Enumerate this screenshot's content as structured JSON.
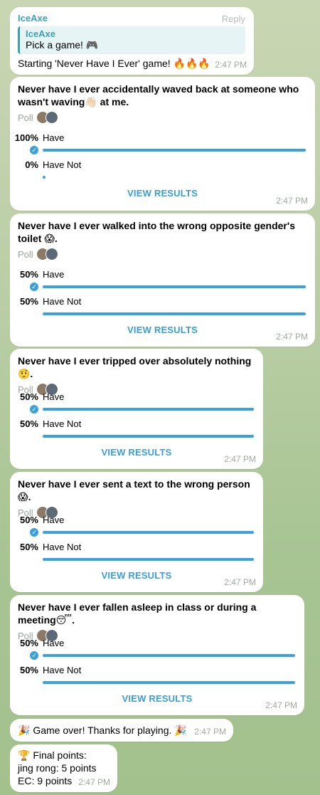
{
  "intro": {
    "sender": "IceAxe",
    "reply_label": "Reply",
    "quote_sender": "IceAxe",
    "quote_text": "Pick a game! 🎮",
    "text": "Starting 'Never Have I Ever' game! ",
    "fire": "🔥🔥🔥",
    "time": "2:47 PM"
  },
  "polls": [
    {
      "question": "Never have I ever accidentally waved back at someone who wasn't waving👋🏻 at me.",
      "poll_label": "Poll",
      "options": [
        {
          "pct": "100%",
          "label": "Have",
          "fraction": 1.0,
          "voted": true
        },
        {
          "pct": "0%",
          "label": "Have Not",
          "fraction": 0.0,
          "voted": false
        }
      ],
      "view_results": "VIEW RESULTS",
      "time": "2:47 PM"
    },
    {
      "question": "Never have I ever walked into the wrong opposite gender's toilet 😱.",
      "poll_label": "Poll",
      "options": [
        {
          "pct": "50%",
          "label": "Have",
          "fraction": 1.0,
          "voted": true
        },
        {
          "pct": "50%",
          "label": "Have Not",
          "fraction": 1.0,
          "voted": false
        }
      ],
      "view_results": "VIEW RESULTS",
      "time": "2:47 PM"
    },
    {
      "question": "Never have I ever tripped over absolutely nothing🤨.",
      "poll_label": "Poll",
      "options": [
        {
          "pct": "50%",
          "label": "Have",
          "fraction": 1.0,
          "voted": true
        },
        {
          "pct": "50%",
          "label": "Have Not",
          "fraction": 1.0,
          "voted": false
        }
      ],
      "view_results": "VIEW RESULTS",
      "time": "2:47 PM"
    },
    {
      "question": "Never have I ever sent a text to the wrong person😱.",
      "poll_label": "Poll",
      "options": [
        {
          "pct": "50%",
          "label": "Have",
          "fraction": 1.0,
          "voted": true
        },
        {
          "pct": "50%",
          "label": "Have Not",
          "fraction": 1.0,
          "voted": false
        }
      ],
      "view_results": "VIEW RESULTS",
      "time": "2:47 PM"
    },
    {
      "question": "Never have I ever fallen asleep in class or during a meeting😴.",
      "poll_label": "Poll",
      "options": [
        {
          "pct": "50%",
          "label": "Have",
          "fraction": 1.0,
          "voted": true
        },
        {
          "pct": "50%",
          "label": "Have Not",
          "fraction": 1.0,
          "voted": false
        }
      ],
      "view_results": "VIEW RESULTS",
      "time": "2:47 PM"
    }
  ],
  "game_over": {
    "text": "🎉 Game over! Thanks for playing. 🎉",
    "time": "2:47 PM"
  },
  "final": {
    "title": "🏆 Final points:",
    "lines": [
      "jing rong: 5 points",
      "EC: 9 points"
    ],
    "time": "2:47 PM"
  },
  "colors": {
    "accent": "#3aa0de",
    "sender": "#3aa1b5"
  }
}
